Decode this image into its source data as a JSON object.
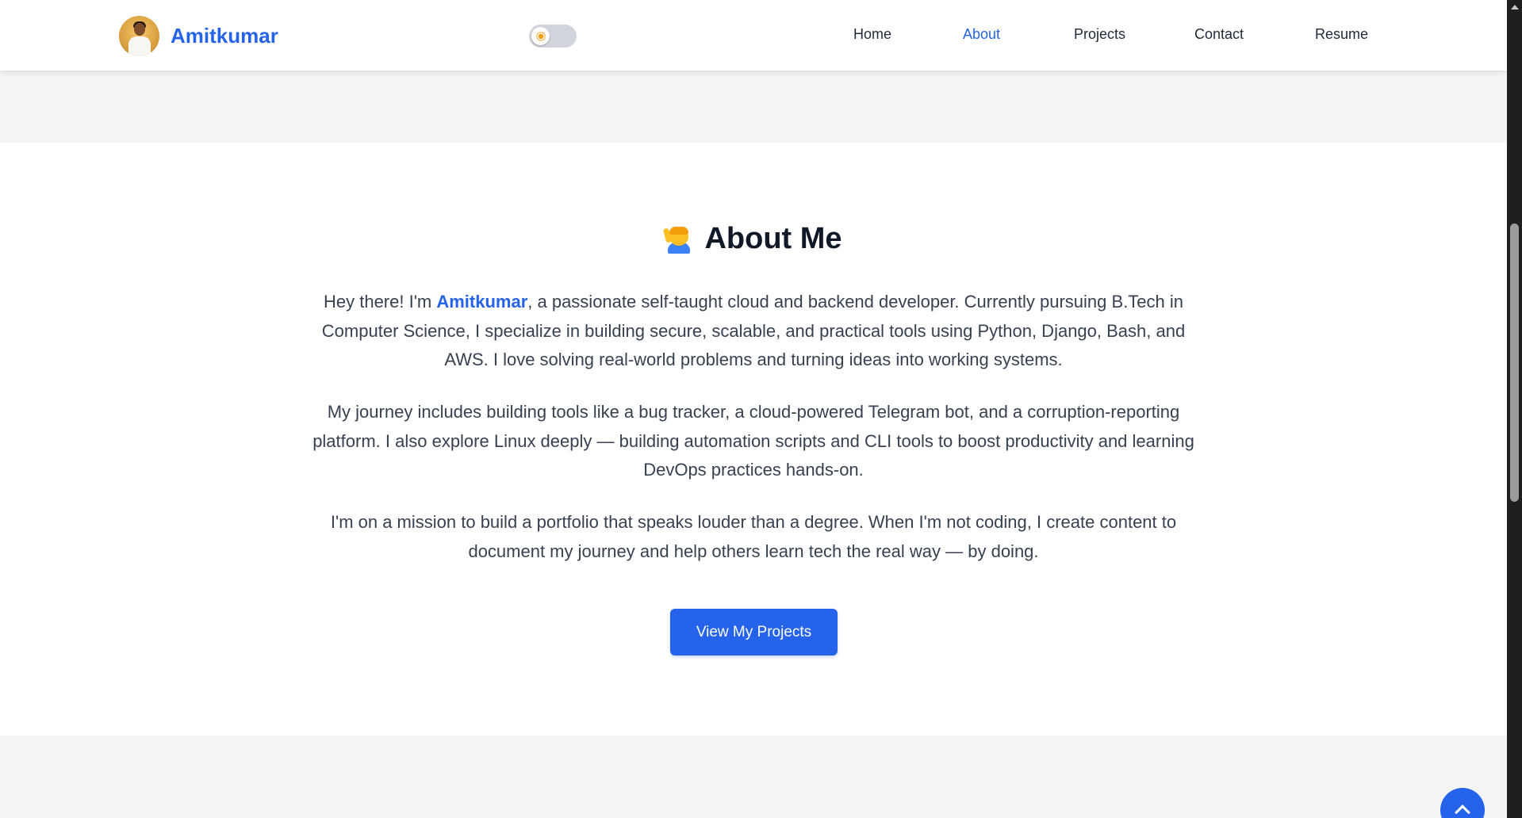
{
  "brand": {
    "name": "Amitkumar"
  },
  "theme_toggle": {
    "mode": "light"
  },
  "nav": {
    "items": [
      {
        "label": "Home",
        "active": false
      },
      {
        "label": "About",
        "active": true
      },
      {
        "label": "Projects",
        "active": false
      },
      {
        "label": "Contact",
        "active": false
      },
      {
        "label": "Resume",
        "active": false
      }
    ]
  },
  "about": {
    "title": "About Me",
    "p1_before": "Hey there! I'm ",
    "p1_name": "Amitkumar",
    "p1_after": ", a passionate self-taught cloud and backend developer. Currently pursuing B.Tech in Computer Science, I specialize in building secure, scalable, and practical tools using Python, Django, Bash, and AWS. I love solving real-world problems and turning ideas into working systems.",
    "p2": "My journey includes building tools like a bug tracker, a cloud-powered Telegram bot, and a corruption-reporting platform. I also explore Linux deeply — building automation scripts and CLI tools to boost productivity and learning DevOps practices hands-on.",
    "p3": "I'm on a mission to build a portfolio that speaks louder than a degree. When I'm not coding, I create content to document my journey and help others learn tech the real way — by doing.",
    "cta_label": "View My Projects"
  },
  "colors": {
    "accent": "#2563eb",
    "page_bg": "#f3f4f6",
    "section_bg": "#ffffff",
    "text": "#374151"
  }
}
